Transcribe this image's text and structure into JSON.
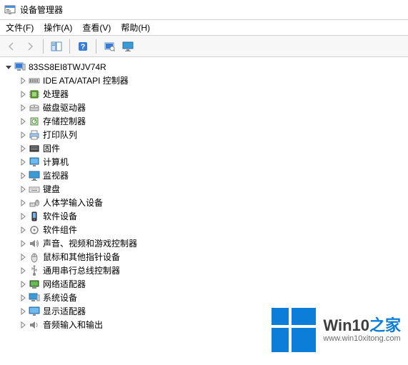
{
  "title": "设备管理器",
  "menu": {
    "file": "文件(F)",
    "action": "操作(A)",
    "view": "查看(V)",
    "help": "帮助(H)"
  },
  "toolbar": {
    "back": "后退",
    "forward": "前进",
    "showhide": "显示/隐藏控制台树",
    "help": "帮助",
    "scan": "扫描硬件更改",
    "monitor": "查看"
  },
  "root": {
    "label": "83SS8EI8TWJV74R"
  },
  "items": [
    {
      "label": "IDE ATA/ATAPI 控制器",
      "icon": "ide"
    },
    {
      "label": "处理器",
      "icon": "cpu"
    },
    {
      "label": "磁盘驱动器",
      "icon": "disk"
    },
    {
      "label": "存储控制器",
      "icon": "storage"
    },
    {
      "label": "打印队列",
      "icon": "printer"
    },
    {
      "label": "固件",
      "icon": "firmware"
    },
    {
      "label": "计算机",
      "icon": "computer"
    },
    {
      "label": "监视器",
      "icon": "monitor"
    },
    {
      "label": "键盘",
      "icon": "keyboard"
    },
    {
      "label": "人体学输入设备",
      "icon": "hid"
    },
    {
      "label": "软件设备",
      "icon": "swdev"
    },
    {
      "label": "软件组件",
      "icon": "swcomp"
    },
    {
      "label": "声音、视频和游戏控制器",
      "icon": "sound"
    },
    {
      "label": "鼠标和其他指针设备",
      "icon": "mouse"
    },
    {
      "label": "通用串行总线控制器",
      "icon": "usb"
    },
    {
      "label": "网络适配器",
      "icon": "network"
    },
    {
      "label": "系统设备",
      "icon": "system"
    },
    {
      "label": "显示适配器",
      "icon": "display"
    },
    {
      "label": "音频输入和输出",
      "icon": "audio"
    }
  ],
  "watermark": {
    "brand_a": "Win10",
    "brand_b": "之家",
    "url": "www.win10xitong.com"
  }
}
